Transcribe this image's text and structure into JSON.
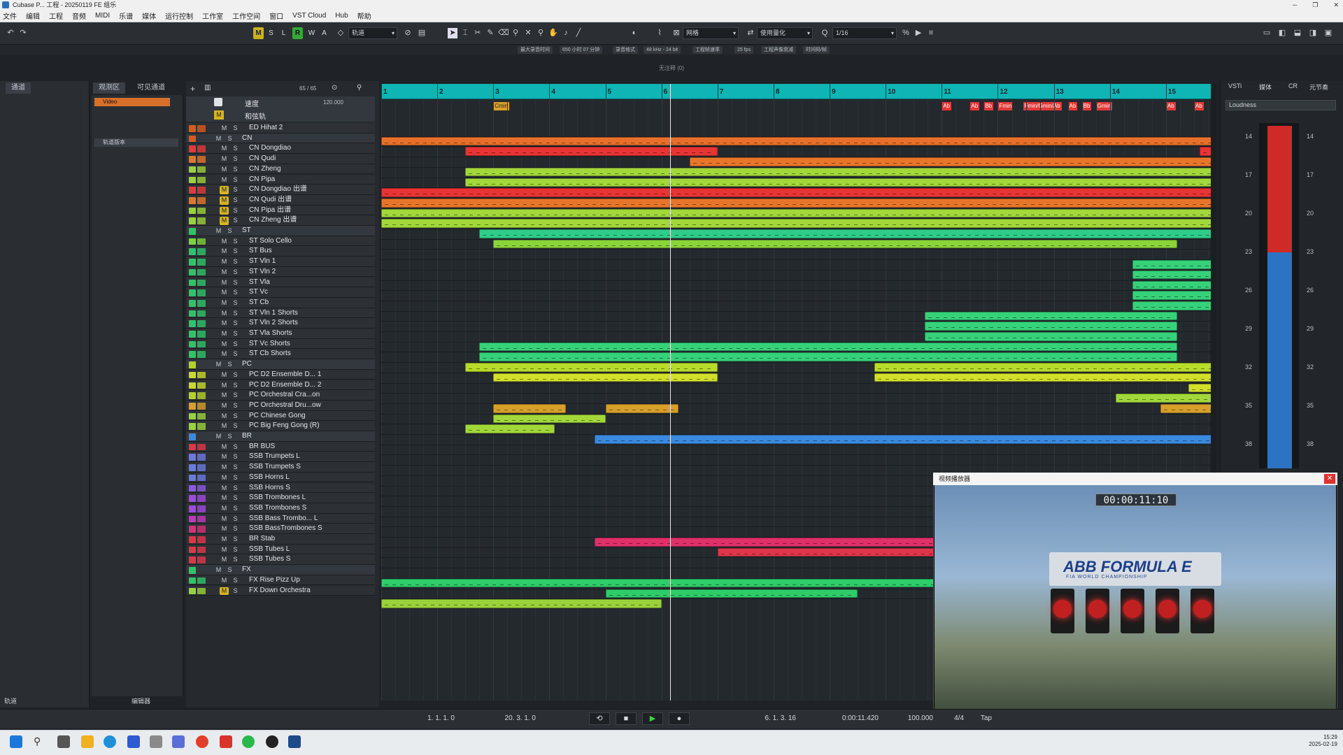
{
  "window": {
    "title": "Cubase P... 工程 - 20250119 FE 组乐"
  },
  "menu": [
    "文件",
    "编辑",
    "工程",
    "音频",
    "MIDI",
    "乐谱",
    "媒体",
    "运行控制",
    "工作室",
    "工作空间",
    "窗口",
    "VST Cloud",
    "Hub",
    "帮助"
  ],
  "toolbar": {
    "m": "M",
    "s": "S",
    "l": "L",
    "r": "R",
    "w": "W",
    "a": "A",
    "mode_label": "轨道",
    "snap_label": "网格",
    "quant_label": "使用量化",
    "quant_value": "1/16"
  },
  "info": [
    "最大录音时间",
    "650 小时 07 分钟",
    "录音格式",
    "48 kHz - 24 bit",
    "工程帧速率",
    "25 fps",
    "工程声像衰减",
    "时间码/帧"
  ],
  "subtitle": "无注释 (0)",
  "left_tabs": {
    "tab1": "通道",
    "tab2": "观测区",
    "tab3": "可见通道",
    "bottom1": "轨道",
    "bottom2": "编辑器"
  },
  "inspector": {
    "video_label": "Video",
    "section": "轨道版本"
  },
  "track_header": {
    "label": "速度",
    "value": "120.000",
    "chord": "和弦轨",
    "counter": "65 / 65"
  },
  "tracks": [
    {
      "name": "ED Hihat 2",
      "m": "M",
      "s": "S",
      "color": "#d85a1e",
      "folder": false,
      "mon": false
    },
    {
      "name": "CN",
      "m": "M",
      "s": "S",
      "color": "#d85a1e",
      "folder": true,
      "mon": false
    },
    {
      "name": "CN Dongdiao",
      "m": "M",
      "s": "S",
      "color": "#e33a3a",
      "folder": false,
      "mon": false
    },
    {
      "name": "CN Qudi",
      "m": "M",
      "s": "S",
      "color": "#e3762a",
      "folder": false,
      "mon": false
    },
    {
      "name": "CN Zheng",
      "m": "M",
      "s": "S",
      "color": "#9ad23a",
      "folder": false,
      "mon": false
    },
    {
      "name": "CN Pipa",
      "m": "M",
      "s": "S",
      "color": "#9ad23a",
      "folder": false,
      "mon": false
    },
    {
      "name": "CN Dongdiao 出谱",
      "m": "M",
      "s": "S",
      "color": "#e33a3a",
      "folder": false,
      "mon": true
    },
    {
      "name": "CN Qudi 出谱",
      "m": "M",
      "s": "S",
      "color": "#e3762a",
      "folder": false,
      "mon": true
    },
    {
      "name": "CN Pipa 出谱",
      "m": "M",
      "s": "S",
      "color": "#9ad23a",
      "folder": false,
      "mon": true
    },
    {
      "name": "CN Zheng 出谱",
      "m": "M",
      "s": "S",
      "color": "#9ad23a",
      "folder": false,
      "mon": true
    },
    {
      "name": "ST",
      "m": "M",
      "s": "S",
      "color": "#2fc46a",
      "folder": true,
      "mon": false
    },
    {
      "name": "ST Solo Cello",
      "m": "M",
      "s": "S",
      "color": "#7ed23a",
      "folder": false,
      "mon": false
    },
    {
      "name": "ST Bus",
      "m": "M",
      "s": "S",
      "color": "#2fc46a",
      "folder": false,
      "mon": false
    },
    {
      "name": "ST Vln 1",
      "m": "M",
      "s": "S",
      "color": "#2fc46a",
      "folder": false,
      "mon": false
    },
    {
      "name": "ST Vln 2",
      "m": "M",
      "s": "S",
      "color": "#2fc46a",
      "folder": false,
      "mon": false
    },
    {
      "name": "ST Vla",
      "m": "M",
      "s": "S",
      "color": "#2fc46a",
      "folder": false,
      "mon": false
    },
    {
      "name": "ST Vc",
      "m": "M",
      "s": "S",
      "color": "#2fc46a",
      "folder": false,
      "mon": false
    },
    {
      "name": "ST Cb",
      "m": "M",
      "s": "S",
      "color": "#2fc46a",
      "folder": false,
      "mon": false
    },
    {
      "name": "ST Vln 1 Shorts",
      "m": "M",
      "s": "S",
      "color": "#2fc46a",
      "folder": false,
      "mon": false
    },
    {
      "name": "ST Vln 2 Shorts",
      "m": "M",
      "s": "S",
      "color": "#2fc46a",
      "folder": false,
      "mon": false
    },
    {
      "name": "ST Vla Shorts",
      "m": "M",
      "s": "S",
      "color": "#2fc46a",
      "folder": false,
      "mon": false
    },
    {
      "name": "ST Vc Shorts",
      "m": "M",
      "s": "S",
      "color": "#2fc46a",
      "folder": false,
      "mon": false
    },
    {
      "name": "ST Cb Shorts",
      "m": "M",
      "s": "S",
      "color": "#2fc46a",
      "folder": false,
      "mon": false
    },
    {
      "name": "PC",
      "m": "M",
      "s": "S",
      "color": "#b4d22a",
      "folder": true,
      "mon": false
    },
    {
      "name": "PC D2 Ensemble D... 1",
      "m": "M",
      "s": "S",
      "color": "#c8dc28",
      "folder": false,
      "mon": false
    },
    {
      "name": "PC D2 Ensemble D... 2",
      "m": "M",
      "s": "S",
      "color": "#c8dc28",
      "folder": false,
      "mon": false
    },
    {
      "name": "PC Orchestral Cra...on",
      "m": "M",
      "s": "S",
      "color": "#b4d22a",
      "folder": false,
      "mon": false
    },
    {
      "name": "PC Orchestral Dru...ow",
      "m": "M",
      "s": "S",
      "color": "#d8a02a",
      "folder": false,
      "mon": false
    },
    {
      "name": "PC Chinese Gong",
      "m": "M",
      "s": "S",
      "color": "#9ad23a",
      "folder": false,
      "mon": false
    },
    {
      "name": "PC Big Feng Gong (R)",
      "m": "M",
      "s": "S",
      "color": "#9ad23a",
      "folder": false,
      "mon": false
    },
    {
      "name": "BR",
      "m": "M",
      "s": "S",
      "color": "#3a8ae0",
      "folder": true,
      "mon": false
    },
    {
      "name": "BR BUS",
      "m": "M",
      "s": "S",
      "color": "#e0364a",
      "folder": false,
      "mon": false
    },
    {
      "name": "SSB Trumpets L",
      "m": "M",
      "s": "S",
      "color": "#6a7ae0",
      "folder": false,
      "mon": false
    },
    {
      "name": "SSB Trumpets S",
      "m": "M",
      "s": "S",
      "color": "#6a7ae0",
      "folder": false,
      "mon": false
    },
    {
      "name": "SSB Horns L",
      "m": "M",
      "s": "S",
      "color": "#6a7ae0",
      "folder": false,
      "mon": false
    },
    {
      "name": "SSB Horns S",
      "m": "M",
      "s": "S",
      "color": "#8a5ae0",
      "folder": false,
      "mon": false
    },
    {
      "name": "SSB Trombones L",
      "m": "M",
      "s": "S",
      "color": "#a04ae0",
      "folder": false,
      "mon": false
    },
    {
      "name": "SSB Trombones S",
      "m": "M",
      "s": "S",
      "color": "#a04ae0",
      "folder": false,
      "mon": false
    },
    {
      "name": "SSB Bass Trombo... L",
      "m": "M",
      "s": "S",
      "color": "#c03ab8",
      "folder": false,
      "mon": false
    },
    {
      "name": "SSB BassTrombones S",
      "m": "M",
      "s": "S",
      "color": "#d8307a",
      "folder": false,
      "mon": false
    },
    {
      "name": "BR Stab",
      "m": "M",
      "s": "S",
      "color": "#e0364a",
      "folder": false,
      "mon": false
    },
    {
      "name": "SSB Tubes L",
      "m": "M",
      "s": "S",
      "color": "#e0364a",
      "folder": false,
      "mon": false
    },
    {
      "name": "SSB Tubes S",
      "m": "M",
      "s": "S",
      "color": "#e0364a",
      "folder": false,
      "mon": false
    },
    {
      "name": "FX",
      "m": "M",
      "s": "S",
      "color": "#2fc46a",
      "folder": true,
      "mon": false
    },
    {
      "name": "FX Rise Pizz Up",
      "m": "M",
      "s": "S",
      "color": "#2fc46a",
      "folder": false,
      "mon": false
    },
    {
      "name": "FX Down Orchestra",
      "m": "M",
      "s": "S",
      "color": "#9ad23a",
      "folder": false,
      "mon": true
    }
  ],
  "ruler": {
    "bars": [
      "1",
      "2",
      "3",
      "4",
      "5",
      "6",
      "7",
      "8",
      "9",
      "10",
      "11",
      "12",
      "13",
      "14",
      "15"
    ]
  },
  "chord_marker": "Cmin",
  "markers": [
    "Ab",
    "Ab",
    "Bb",
    "Fmin",
    "Fmin/Gmin/Ab",
    "Ab",
    "Bb",
    "Gmin",
    "Ab",
    "Ab"
  ],
  "parts": [
    {
      "row": 1,
      "s": 0,
      "e": 15,
      "c": "#e8702a"
    },
    {
      "row": 2,
      "s": 1.5,
      "e": 6,
      "c": "#e83434"
    },
    {
      "row": 2,
      "s": 14.6,
      "e": 15,
      "c": "#e83434"
    },
    {
      "row": 3,
      "s": 5.5,
      "e": 15,
      "c": "#e8762a"
    },
    {
      "row": 4,
      "s": 1.5,
      "e": 15,
      "c": "#a2d83a"
    },
    {
      "row": 5,
      "s": 1.5,
      "e": 15,
      "c": "#a2d83a"
    },
    {
      "row": 6,
      "s": 0,
      "e": 15,
      "c": "#e83434"
    },
    {
      "row": 7,
      "s": 0,
      "e": 15,
      "c": "#e8762a"
    },
    {
      "row": 8,
      "s": 0,
      "e": 15,
      "c": "#a2d83a"
    },
    {
      "row": 9,
      "s": 0,
      "e": 15,
      "c": "#a2d83a"
    },
    {
      "row": 10,
      "s": 1.75,
      "e": 15,
      "c": "#2fcc8a"
    },
    {
      "row": 11,
      "s": 2,
      "e": 14.2,
      "c": "#8ad43a"
    },
    {
      "row": 13,
      "s": 13.4,
      "e": 15,
      "c": "#36d27a"
    },
    {
      "row": 14,
      "s": 13.4,
      "e": 15,
      "c": "#36d27a"
    },
    {
      "row": 15,
      "s": 13.4,
      "e": 15,
      "c": "#36d27a"
    },
    {
      "row": 16,
      "s": 13.4,
      "e": 15,
      "c": "#36d27a"
    },
    {
      "row": 17,
      "s": 13.4,
      "e": 15,
      "c": "#36d27a"
    },
    {
      "row": 18,
      "s": 9.7,
      "e": 14.2,
      "c": "#36d27a"
    },
    {
      "row": 19,
      "s": 9.7,
      "e": 14.2,
      "c": "#36d27a"
    },
    {
      "row": 20,
      "s": 9.7,
      "e": 14.2,
      "c": "#36d27a"
    },
    {
      "row": 21,
      "s": 1.75,
      "e": 14.2,
      "c": "#36d27a"
    },
    {
      "row": 22,
      "s": 1.75,
      "e": 14.2,
      "c": "#36d27a"
    },
    {
      "row": 23,
      "s": 1.5,
      "e": 6,
      "c": "#b8dc2a"
    },
    {
      "row": 23,
      "s": 8.8,
      "e": 15,
      "c": "#b8dc2a"
    },
    {
      "row": 24,
      "s": 2,
      "e": 6,
      "c": "#d2e02a"
    },
    {
      "row": 24,
      "s": 8.8,
      "e": 15,
      "c": "#d2e02a"
    },
    {
      "row": 25,
      "s": 14.4,
      "e": 15,
      "c": "#d2e02a"
    },
    {
      "row": 26,
      "s": 13.1,
      "e": 15,
      "c": "#a2d83a"
    },
    {
      "row": 27,
      "s": 2,
      "e": 3.3,
      "c": "#d8a02a"
    },
    {
      "row": 27,
      "s": 4,
      "e": 5.3,
      "c": "#d8a02a"
    },
    {
      "row": 27,
      "s": 13.9,
      "e": 15,
      "c": "#d8a02a"
    },
    {
      "row": 28,
      "s": 2,
      "e": 4,
      "c": "#a2d83a"
    },
    {
      "row": 29,
      "s": 1.5,
      "e": 3.1,
      "c": "#a2d83a"
    },
    {
      "row": 30,
      "s": 3.8,
      "e": 15,
      "c": "#3a8ae0"
    },
    {
      "row": 40,
      "s": 3.8,
      "e": 15,
      "c": "#e0306a"
    },
    {
      "row": 41,
      "s": 6,
      "e": 15,
      "c": "#e0364a"
    },
    {
      "row": 44,
      "s": 0,
      "e": 15,
      "c": "#2fcc6a"
    },
    {
      "row": 45,
      "s": 4,
      "e": 8.5,
      "c": "#2fcc6a"
    },
    {
      "row": 46,
      "s": 0,
      "e": 5,
      "c": "#9ad23a"
    }
  ],
  "right_panel": {
    "tab1": "VSTi",
    "tab2": "媒体",
    "tab3": "CR",
    "tab4": "元节奏",
    "loudness": "Loudness",
    "scale": [
      "14",
      "17",
      "20",
      "23",
      "26",
      "29",
      "32",
      "35",
      "38"
    ]
  },
  "video": {
    "title": "视频播放器",
    "timecode": "00:00:11:10",
    "arch_text": "ABB FORMULA E",
    "arch_sub": "FIA WORLD CHAMPIONSHIP"
  },
  "transport": {
    "left_locator": "1. 1. 1. 0",
    "right_locator": "20. 3. 1. 0",
    "position": "6. 1. 3. 16",
    "time": "0:00:11.420",
    "tempo": "100.000",
    "signature": "4/4",
    "tap": "Tap"
  },
  "taskbar": {
    "time": "15:29",
    "date": "2025-02-19"
  }
}
